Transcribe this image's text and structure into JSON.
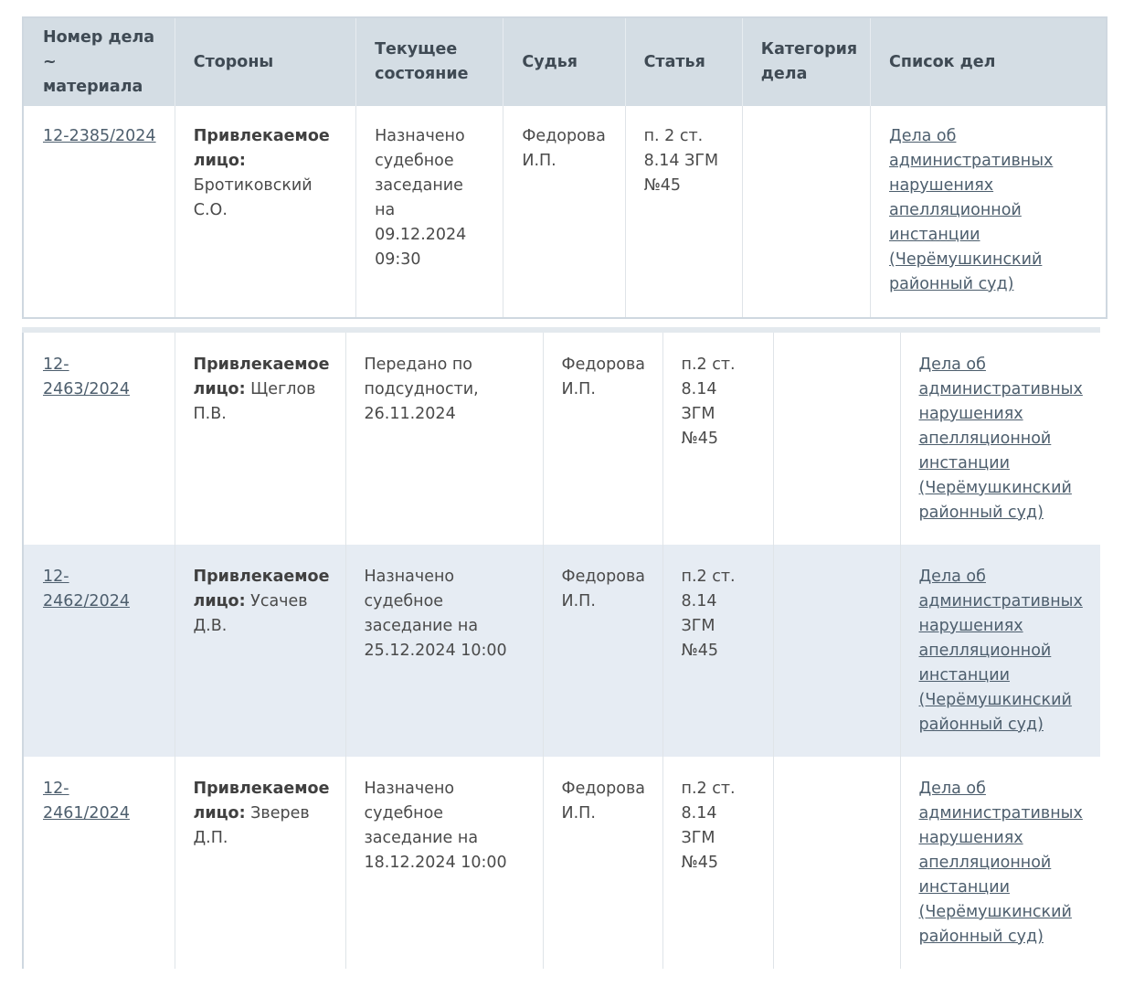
{
  "headers": {
    "case_number": "Номер дела ~ материала",
    "parties": "Стороны",
    "status": "Текущее состояние",
    "judge": "Судья",
    "article": "Статья",
    "category": "Категория дела",
    "list": "Список дел"
  },
  "colors": {
    "header_bg": "#d4dde4",
    "row_alt_bg": "#e6ecf3",
    "link": "#4d5e6d",
    "border": "#cfd8e0"
  },
  "cases": [
    {
      "number": "12-2385/2024",
      "party_role": "Привлекаемое лицо:",
      "party_name": "Бротиковский С.О.",
      "status": "Назначено судебное заседание на 09.12.2024 09:30",
      "judge": "Федорова И.П.",
      "article": "п. 2 ст. 8.14 ЗГМ №45",
      "category": "",
      "list": "Дела об административных нарушениях апелляционной инстанции (Черёмушкинский районный суд)"
    },
    {
      "number": "12-2463/2024",
      "party_role": "Привлекаемое лицо:",
      "party_name": "Щеглов П.В.",
      "status": "Передано по подсудности, 26.11.2024",
      "judge": "Федорова И.П.",
      "article": "п.2 ст. 8.14 ЗГМ №45",
      "category": "",
      "list": "Дела об административных нарушениях апелляционной инстанции (Черёмушкинский районный суд)"
    },
    {
      "number": "12-2462/2024",
      "party_role": "Привлекаемое лицо:",
      "party_name": "Усачев Д.В.",
      "status": "Назначено судебное заседание на 25.12.2024 10:00",
      "judge": "Федорова И.П.",
      "article": "п.2 ст. 8.14 ЗГМ №45",
      "category": "",
      "list": "Дела об административных нарушениях апелляционной инстанции (Черёмушкинский районный суд)"
    },
    {
      "number": "12-2461/2024",
      "party_role": "Привлекаемое лицо:",
      "party_name": "Зверев Д.П.",
      "status": "Назначено судебное заседание на 18.12.2024 10:00",
      "judge": "Федорова И.П.",
      "article": "п.2 ст. 8.14 ЗГМ №45",
      "category": "",
      "list": "Дела об административных нарушениях апелляционной инстанции (Черёмушкинский районный суд)"
    }
  ]
}
